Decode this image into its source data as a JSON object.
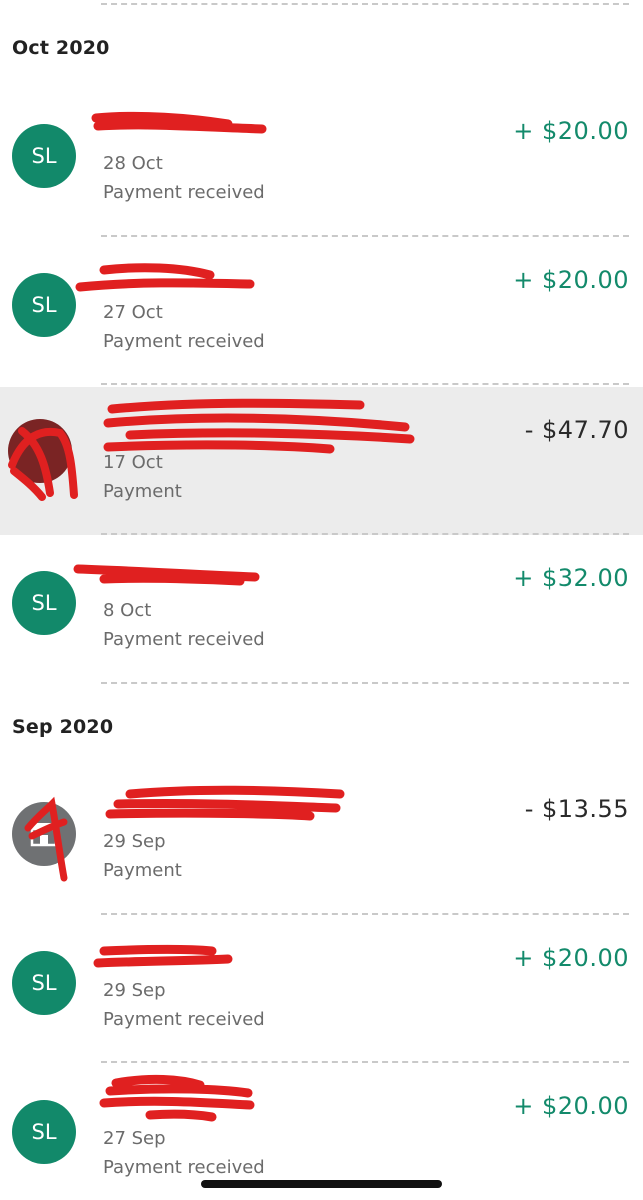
{
  "sections": [
    {
      "header": "Oct 2020",
      "transactions": [
        {
          "name": "",
          "initials": "SL",
          "date": "28 Oct",
          "type": "Payment received",
          "amount": "+ $20.00",
          "avatar_icon": "initials-avatar"
        },
        {
          "name": "",
          "initials": "SL",
          "date": "27 Oct",
          "type": "Payment received",
          "amount": "+ $20.00",
          "avatar_icon": "initials-avatar"
        },
        {
          "name": "",
          "initials": "",
          "date": "17 Oct",
          "type": "Payment",
          "amount": "- $47.70",
          "avatar_icon": "merchant-logo-avatar"
        },
        {
          "name": "",
          "initials": "SL",
          "date": "8 Oct",
          "type": "Payment received",
          "amount": "+ $32.00",
          "avatar_icon": "initials-avatar"
        }
      ]
    },
    {
      "header": "Sep 2020",
      "transactions": [
        {
          "name": "",
          "initials": "",
          "date": "29 Sep",
          "type": "Payment",
          "amount": "- $13.55",
          "avatar_icon": "store-icon"
        },
        {
          "name": "",
          "initials": "SL",
          "date": "29 Sep",
          "type": "Payment received",
          "amount": "+ $20.00",
          "avatar_icon": "initials-avatar"
        },
        {
          "name": "",
          "initials": "SL",
          "date": "27 Sep",
          "type": "Payment received",
          "amount": "+ $20.00",
          "avatar_icon": "initials-avatar"
        }
      ]
    }
  ],
  "colors": {
    "credit": "#138a6b",
    "debit": "#2a2a2a",
    "avatar": "#12896a",
    "highlight_row": "#ececec",
    "redaction": "#e02020"
  }
}
